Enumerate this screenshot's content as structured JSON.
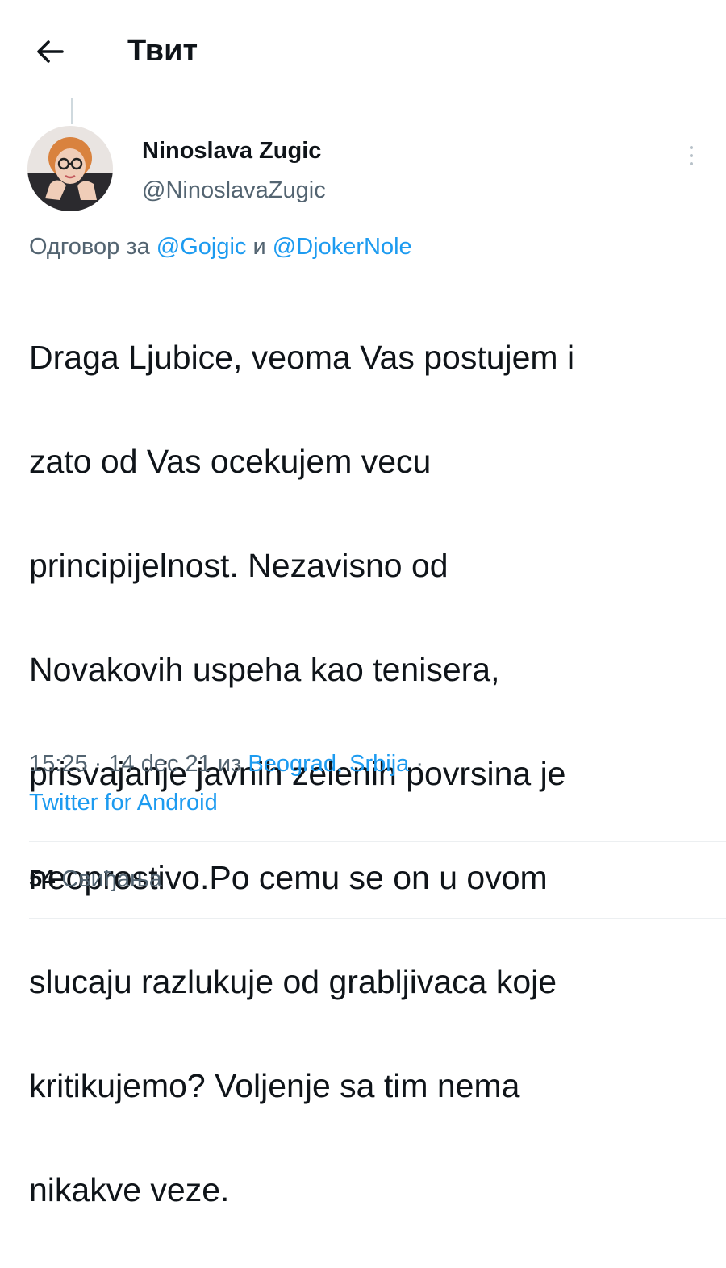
{
  "header": {
    "title": "Твит",
    "back_icon": "arrow-left-icon"
  },
  "author": {
    "display_name": "Ninoslava Zugic",
    "username": "@NinoslavaZugic",
    "avatar_icon": "avatar-photo"
  },
  "more_icon": "vertical-ellipsis-icon",
  "reply": {
    "prefix": "Одговор за",
    "mention_1": "@Gojgic",
    "conjunction": "и",
    "mention_2": "@DjokerNole"
  },
  "tweet": {
    "text_lines": [
      "Draga Ljubice, veoma Vas postujem i",
      "zato od Vas ocekujem vecu",
      "principijelnost. Nezavisno od",
      "Novakovih uspeha kao tenisera,",
      "prisvajanje javnih zelenih povrsina je",
      "neoprostivo.Po cemu se on u ovom",
      "slucaju razlukuje od grabljivaca koje",
      "kritikujemo? Voljenje sa tim nema",
      "nikakve veze."
    ]
  },
  "meta": {
    "time": "15:25",
    "date": "14 dec 21",
    "location_prefix": "из",
    "location": "Beograd, Srbija",
    "source": "Twitter for Android",
    "separator": "·"
  },
  "stats": {
    "likes_count": "54",
    "likes_label": "Свиђања"
  },
  "colors": {
    "text": "#0f1419",
    "secondary": "#536471",
    "accent": "#1d9bf0",
    "divider": "#eceff1"
  }
}
